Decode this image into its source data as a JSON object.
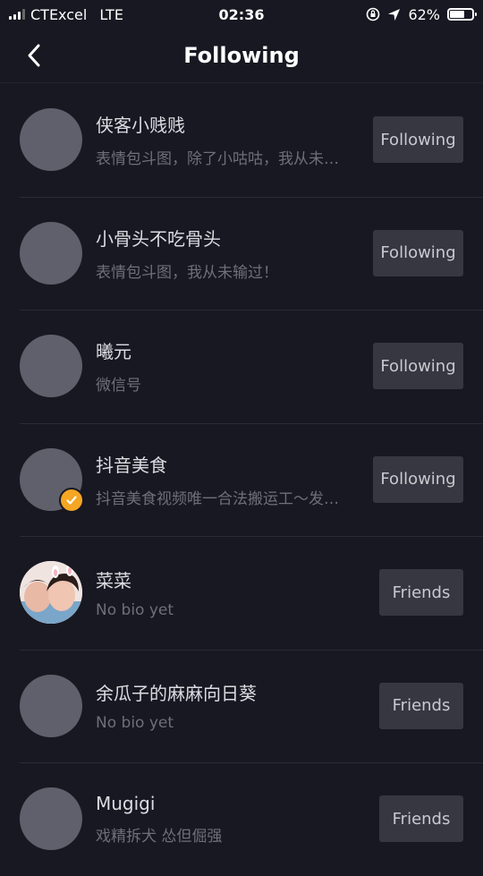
{
  "status_bar": {
    "carrier": "CTExcel",
    "network": "LTE",
    "time": "02:36",
    "battery": "62%"
  },
  "header": {
    "title": "Following",
    "back_icon": "chevron-left-icon"
  },
  "users": [
    {
      "name": "侠客小贱贱",
      "bio": "表情包斗图，除了小咕咕，我从未输过！",
      "button": "Following",
      "avatar": "placeholder"
    },
    {
      "name": "小骨头不吃骨头",
      "bio": "表情包斗图，我从未输过！",
      "button": "Following",
      "avatar": "placeholder"
    },
    {
      "name": "曦元",
      "bio": "微信号",
      "button": "Following",
      "avatar": "placeholder"
    },
    {
      "name": "抖音美食",
      "bio": "抖音美食视频唯一合法搬运工～发现更多美食",
      "button": "Following",
      "avatar": "placeholder",
      "verified": true
    },
    {
      "name": "菜菜",
      "bio": "No bio yet",
      "button": "Friends",
      "avatar": "photo"
    },
    {
      "name": "余瓜子的麻麻向日葵",
      "bio": "No bio yet",
      "button": "Friends",
      "avatar": "placeholder"
    },
    {
      "name": "Mugigi",
      "bio": "戏精拆犬  怂但倔强",
      "button": "Friends",
      "avatar": "placeholder"
    }
  ],
  "colors": {
    "background": "#171821",
    "button_bg": "#363740",
    "verified": "#f5a623"
  }
}
